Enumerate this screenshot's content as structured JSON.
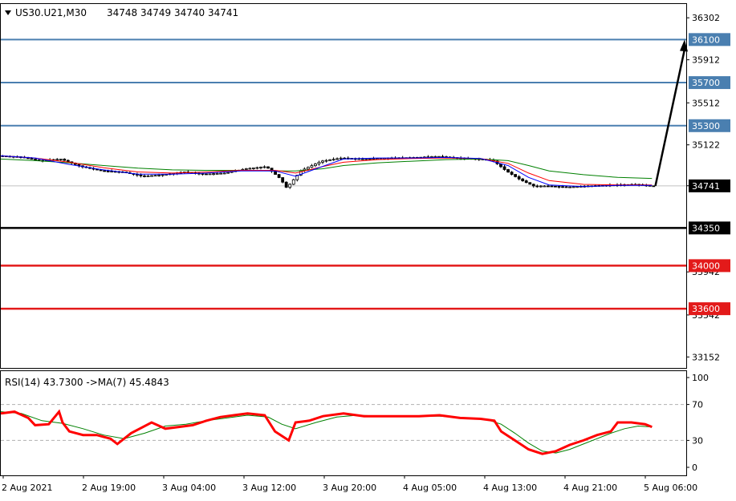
{
  "header": {
    "symbol": "US30.U21,M30",
    "ohlc": "34748 34749 34740 34741"
  },
  "colors": {
    "resistance": "#4a7fb0",
    "support": "#e31a1a",
    "pivot": "#000000",
    "candle": "#000000",
    "ma_fast": "#0000ff",
    "ma_mid": "#ff0000",
    "ma_slow": "#008000",
    "current_line": "#c0c0c0",
    "rsi": "#ff0000",
    "rsi_ma": "#008000"
  },
  "chart_data": [
    {
      "type": "candlestick",
      "y_ticks": [
        36302,
        35912,
        35512,
        35122,
        34742,
        33942,
        33542,
        33152
      ],
      "ylim": [
        33050,
        36430
      ],
      "current_price": 34741,
      "levels": [
        {
          "value": 36100,
          "label": "36100",
          "kind": "resistance"
        },
        {
          "value": 35700,
          "label": "35700",
          "kind": "resistance"
        },
        {
          "value": 35300,
          "label": "35300",
          "kind": "resistance"
        },
        {
          "value": 34350,
          "label": "34350",
          "kind": "pivot"
        },
        {
          "value": 34000,
          "label": "34000",
          "kind": "support"
        },
        {
          "value": 33600,
          "label": "33600",
          "kind": "support"
        }
      ],
      "current_label": "34741",
      "projection": {
        "from": 34741,
        "to": 36100
      },
      "price_path": [
        [
          0,
          35020
        ],
        [
          0.03,
          35010
        ],
        [
          0.06,
          34975
        ],
        [
          0.09,
          34990
        ],
        [
          0.12,
          34920
        ],
        [
          0.15,
          34880
        ],
        [
          0.18,
          34870
        ],
        [
          0.21,
          34830
        ],
        [
          0.24,
          34845
        ],
        [
          0.27,
          34870
        ],
        [
          0.3,
          34850
        ],
        [
          0.33,
          34860
        ],
        [
          0.36,
          34900
        ],
        [
          0.39,
          34920
        ],
        [
          0.41,
          34810
        ],
        [
          0.42,
          34720
        ],
        [
          0.44,
          34880
        ],
        [
          0.47,
          34970
        ],
        [
          0.5,
          35000
        ],
        [
          0.53,
          34990
        ],
        [
          0.57,
          35000
        ],
        [
          0.61,
          35005
        ],
        [
          0.64,
          35015
        ],
        [
          0.67,
          35000
        ],
        [
          0.7,
          34990
        ],
        [
          0.72,
          34980
        ],
        [
          0.74,
          34880
        ],
        [
          0.76,
          34800
        ],
        [
          0.78,
          34740
        ],
        [
          0.8,
          34740
        ],
        [
          0.83,
          34730
        ],
        [
          0.86,
          34740
        ],
        [
          0.9,
          34750
        ],
        [
          0.93,
          34755
        ],
        [
          0.95,
          34741
        ]
      ],
      "ma_fast": [
        [
          0,
          35020
        ],
        [
          0.05,
          35000
        ],
        [
          0.1,
          34940
        ],
        [
          0.15,
          34890
        ],
        [
          0.2,
          34850
        ],
        [
          0.25,
          34850
        ],
        [
          0.3,
          34860
        ],
        [
          0.35,
          34880
        ],
        [
          0.4,
          34880
        ],
        [
          0.43,
          34830
        ],
        [
          0.46,
          34900
        ],
        [
          0.5,
          34990
        ],
        [
          0.55,
          35000
        ],
        [
          0.6,
          35000
        ],
        [
          0.65,
          35005
        ],
        [
          0.7,
          34995
        ],
        [
          0.74,
          34930
        ],
        [
          0.77,
          34820
        ],
        [
          0.8,
          34750
        ],
        [
          0.85,
          34735
        ],
        [
          0.9,
          34745
        ],
        [
          0.95,
          34745
        ]
      ],
      "ma_mid": [
        [
          0,
          35020
        ],
        [
          0.05,
          35000
        ],
        [
          0.1,
          34960
        ],
        [
          0.15,
          34910
        ],
        [
          0.2,
          34870
        ],
        [
          0.25,
          34860
        ],
        [
          0.3,
          34870
        ],
        [
          0.35,
          34885
        ],
        [
          0.4,
          34885
        ],
        [
          0.43,
          34860
        ],
        [
          0.47,
          34920
        ],
        [
          0.5,
          34960
        ],
        [
          0.55,
          34985
        ],
        [
          0.6,
          34995
        ],
        [
          0.65,
          35000
        ],
        [
          0.7,
          34995
        ],
        [
          0.74,
          34950
        ],
        [
          0.77,
          34860
        ],
        [
          0.8,
          34790
        ],
        [
          0.85,
          34755
        ],
        [
          0.9,
          34750
        ],
        [
          0.95,
          34750
        ]
      ],
      "ma_slow": [
        [
          0,
          34990
        ],
        [
          0.05,
          34975
        ],
        [
          0.1,
          34955
        ],
        [
          0.15,
          34930
        ],
        [
          0.2,
          34905
        ],
        [
          0.25,
          34890
        ],
        [
          0.3,
          34885
        ],
        [
          0.35,
          34885
        ],
        [
          0.4,
          34880
        ],
        [
          0.43,
          34880
        ],
        [
          0.47,
          34900
        ],
        [
          0.5,
          34930
        ],
        [
          0.55,
          34955
        ],
        [
          0.6,
          34970
        ],
        [
          0.65,
          34985
        ],
        [
          0.7,
          34990
        ],
        [
          0.74,
          34975
        ],
        [
          0.77,
          34930
        ],
        [
          0.8,
          34880
        ],
        [
          0.85,
          34845
        ],
        [
          0.9,
          34820
        ],
        [
          0.95,
          34810
        ]
      ]
    },
    {
      "type": "line",
      "title": "RSI(14) 43.7300  ->MA(7) 45.4843",
      "y_ticks": [
        100,
        70,
        30,
        0
      ],
      "ylim": [
        0,
        100
      ],
      "dashed_levels": [
        70,
        30
      ],
      "series": [
        {
          "name": "RSI(14)",
          "color": "#ff0000",
          "values": [
            [
              0,
              60
            ],
            [
              0.02,
              62
            ],
            [
              0.04,
              55
            ],
            [
              0.05,
              47
            ],
            [
              0.07,
              48
            ],
            [
              0.085,
              62
            ],
            [
              0.09,
              50
            ],
            [
              0.1,
              40
            ],
            [
              0.12,
              36
            ],
            [
              0.14,
              36
            ],
            [
              0.16,
              32
            ],
            [
              0.17,
              26
            ],
            [
              0.19,
              38
            ],
            [
              0.22,
              50
            ],
            [
              0.24,
              43
            ],
            [
              0.26,
              45
            ],
            [
              0.28,
              47
            ],
            [
              0.3,
              52
            ],
            [
              0.32,
              56
            ],
            [
              0.34,
              58
            ],
            [
              0.36,
              60
            ],
            [
              0.385,
              58
            ],
            [
              0.4,
              40
            ],
            [
              0.41,
              35
            ],
            [
              0.42,
              30
            ],
            [
              0.43,
              50
            ],
            [
              0.45,
              52
            ],
            [
              0.47,
              57
            ],
            [
              0.5,
              60
            ],
            [
              0.53,
              57
            ],
            [
              0.57,
              57
            ],
            [
              0.61,
              57
            ],
            [
              0.64,
              58
            ],
            [
              0.67,
              55
            ],
            [
              0.7,
              54
            ],
            [
              0.72,
              52
            ],
            [
              0.73,
              40
            ],
            [
              0.75,
              30
            ],
            [
              0.77,
              20
            ],
            [
              0.79,
              15
            ],
            [
              0.81,
              18
            ],
            [
              0.83,
              25
            ],
            [
              0.85,
              30
            ],
            [
              0.87,
              36
            ],
            [
              0.89,
              40
            ],
            [
              0.9,
              50
            ],
            [
              0.92,
              50
            ],
            [
              0.94,
              48
            ],
            [
              0.95,
              45
            ]
          ]
        },
        {
          "name": "MA(7)",
          "color": "#008000",
          "values": [
            [
              0,
              62
            ],
            [
              0.03,
              60
            ],
            [
              0.06,
              52
            ],
            [
              0.09,
              49
            ],
            [
              0.12,
              43
            ],
            [
              0.15,
              36
            ],
            [
              0.18,
              32
            ],
            [
              0.21,
              38
            ],
            [
              0.24,
              46
            ],
            [
              0.27,
              48
            ],
            [
              0.3,
              52
            ],
            [
              0.33,
              55
            ],
            [
              0.36,
              58
            ],
            [
              0.39,
              56
            ],
            [
              0.41,
              48
            ],
            [
              0.43,
              43
            ],
            [
              0.46,
              50
            ],
            [
              0.49,
              56
            ],
            [
              0.52,
              58
            ],
            [
              0.56,
              57
            ],
            [
              0.6,
              57
            ],
            [
              0.64,
              57
            ],
            [
              0.68,
              55
            ],
            [
              0.71,
              53
            ],
            [
              0.73,
              48
            ],
            [
              0.75,
              38
            ],
            [
              0.77,
              27
            ],
            [
              0.79,
              18
            ],
            [
              0.81,
              16
            ],
            [
              0.83,
              20
            ],
            [
              0.85,
              26
            ],
            [
              0.87,
              32
            ],
            [
              0.89,
              38
            ],
            [
              0.91,
              43
            ],
            [
              0.93,
              46
            ],
            [
              0.95,
              45
            ]
          ]
        }
      ]
    }
  ],
  "x_labels": [
    "2 Aug 2021",
    "2 Aug 19:00",
    "3 Aug 04:00",
    "3 Aug 12:00",
    "3 Aug 20:00",
    "4 Aug 05:00",
    "4 Aug 13:00",
    "4 Aug 21:00",
    "5 Aug 06:00"
  ]
}
